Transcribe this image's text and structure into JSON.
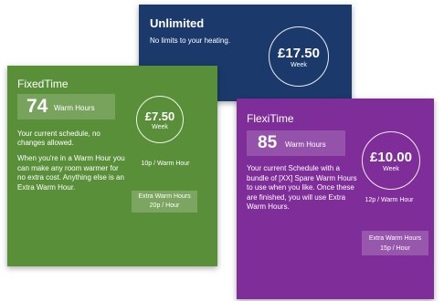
{
  "colors": {
    "unlimited": "#1b3a6b",
    "fixedtime": "#5a8f3a",
    "flexitime": "#7e2d99"
  },
  "unlimited": {
    "title": "Unlimited",
    "description": "No limits to your heating.",
    "price": "£17.50",
    "period": "Week"
  },
  "fixedtime": {
    "title": "FixedTime",
    "hours": "74",
    "hours_label": "Warm Hours",
    "description_1": "Your current schedule, no changes allowed.",
    "description_2": "When you're in a Warm Hour you can make any room warmer for no extra cost. Anything else is an Extra Warm Hour.",
    "price": "£7.50",
    "period": "Week",
    "rate": "10p / Warm Hour",
    "extra_label": "Extra Warm Hours",
    "extra_rate": "20p / Hour"
  },
  "flexitime": {
    "title": "FlexiTime",
    "hours": "85",
    "hours_label": "Warm Hours",
    "description": "Your current Schedule with a bundle of [XX] Spare Warm Hours to use when you like. Once these are finished, you will use Extra Warm Hours.",
    "price": "£10.00",
    "period": "Week",
    "rate": "12p / Warm Hour",
    "extra_label": "Extra Warm Hours",
    "extra_rate": "15p / Hour"
  }
}
